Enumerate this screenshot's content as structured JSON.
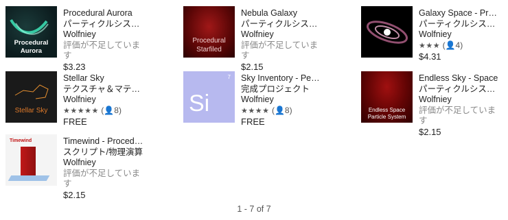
{
  "items": [
    {
      "title": "Procedural Aurora",
      "category": "パーティクルシステム",
      "publisher": "Wolfniey",
      "rating_text": "評価が不足しています",
      "stars": "",
      "rating_count": "",
      "price": "$3.23",
      "thumb_text": "Procedural Aurora",
      "thumb_icon": "aurora-thumbnail"
    },
    {
      "title": "Nebula Galaxy",
      "category": "パーティクルシステム",
      "publisher": "Wolfniey",
      "rating_text": "評価が不足しています",
      "stars": "",
      "rating_count": "",
      "price": "$2.15",
      "thumb_text_1": "Procedural",
      "thumb_text_2": "Starfiled",
      "thumb_icon": "nebula-thumbnail"
    },
    {
      "title": "Galaxy Space - Procedural",
      "category": "パーティクルシステム",
      "publisher": "Wolfniey",
      "rating_text": "",
      "stars": "★★★",
      "rating_count": "4",
      "price": "$4.31",
      "thumb_icon": "galaxy-thumbnail"
    },
    {
      "title": "Stellar Sky",
      "category": "テクスチャ＆マテリアル",
      "publisher": "Wolfniey",
      "rating_text": "",
      "stars": "★★★★★",
      "rating_count": "8",
      "price": "FREE",
      "thumb_text": "Stellar Sky",
      "thumb_icon": "stellar-sky-thumbnail"
    },
    {
      "title": "Sky Inventory - Periodic",
      "category": "完成プロジェクト",
      "publisher": "Wolfniey",
      "rating_text": "",
      "stars": "★★★★",
      "rating_count": "8",
      "price": "FREE",
      "thumb_text": "Si",
      "thumb_number": "7",
      "thumb_icon": "si-element-thumbnail"
    },
    {
      "title": "Endless Sky - Space",
      "category": "パーティクルシステム",
      "publisher": "Wolfniey",
      "rating_text": "評価が不足しています",
      "stars": "",
      "rating_count": "",
      "price": "$2.15",
      "thumb_text_1": "Endless Space",
      "thumb_text_2": "Particle System",
      "thumb_icon": "endless-sky-thumbnail"
    },
    {
      "title": "Timewind - Procedural",
      "category": "スクリプト/物理演算",
      "publisher": "Wolfniey",
      "rating_text": "評価が不足しています",
      "stars": "",
      "rating_count": "",
      "price": "$2.15",
      "thumb_text": "Timewind",
      "thumb_icon": "timewind-thumbnail"
    }
  ],
  "pager": {
    "text": "1 - 7 of 7"
  },
  "icons": {
    "user": "user-icon"
  }
}
